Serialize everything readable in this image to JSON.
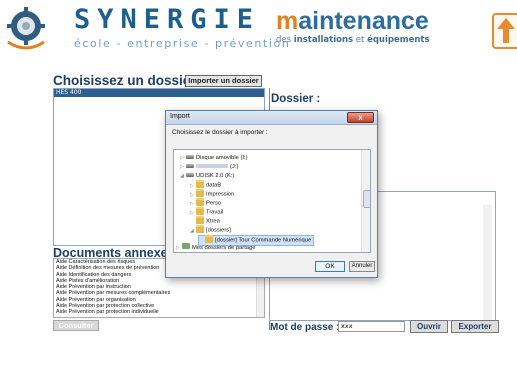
{
  "header": {
    "brand": "SYNERGIE",
    "tagline": "école - entreprise - prévention",
    "product_title_first": "m",
    "product_title_rest": "aintenance",
    "product_sub_prefix": "des",
    "product_sub_bold1": "installations",
    "product_sub_mid": "et",
    "product_sub_bold2": "équipements",
    "colors": {
      "brand": "#1c5f8c",
      "accent": "#e57f22"
    }
  },
  "left_panel": {
    "title": "Choisissez un dossier",
    "import_button": "Importer un dossier",
    "selected_folder": "HES 400",
    "annexes_title": "Documents annexes dis",
    "documents": [
      "Aide Caractérisation des risques",
      "Aide Définition des mesures de prévention",
      "Aide Identification des dangers",
      "Aide Pistes d'amélioration",
      "Aide Prévention par instruction",
      "Aide Prévention par mesures complémentaires",
      "Aide Prévention par organisation",
      "Aide Prévention par protection collective",
      "Aide Prévention par protection individuelle"
    ],
    "consult_button": "Consulter"
  },
  "right_panel": {
    "dossier_label": "Dossier :",
    "password_label": "Mot de passe :",
    "password_value": "xxx",
    "open_button": "Ouvrir",
    "export_button": "Exporter"
  },
  "dialog": {
    "title": "Import",
    "close_label": "x",
    "prompt": "Choisissez le dossier à importer :",
    "tree": [
      {
        "label": "Disque amovible (I:)",
        "icon": "drive-icon",
        "twisty": "▷"
      },
      {
        "label": "(J:)",
        "icon": "drive-icon",
        "twisty": "▷"
      },
      {
        "label": "UDISK 2.0 (K:)",
        "icon": "drive-icon",
        "twisty": "◢"
      },
      {
        "label": "dataB",
        "icon": "folder-icon",
        "twisty": "▷"
      },
      {
        "label": "Impression",
        "icon": "folder-icon",
        "twisty": "▷"
      },
      {
        "label": "Perso",
        "icon": "folder-icon",
        "twisty": "▷"
      },
      {
        "label": "Travail",
        "icon": "folder-icon",
        "twisty": "▷"
      },
      {
        "label": "Xtrea",
        "icon": "folder-icon",
        "twisty": ""
      },
      {
        "label": "[dossiers]",
        "icon": "folder-icon",
        "twisty": "◢"
      },
      {
        "label": "[dossier] Tour Commande Numérique",
        "icon": "folder-icon",
        "twisty": ""
      },
      {
        "label": "Mes dossiers de partage",
        "icon": "network-icon",
        "twisty": "▷"
      }
    ],
    "ok_button": "OK",
    "cancel_button": "Annuler"
  }
}
